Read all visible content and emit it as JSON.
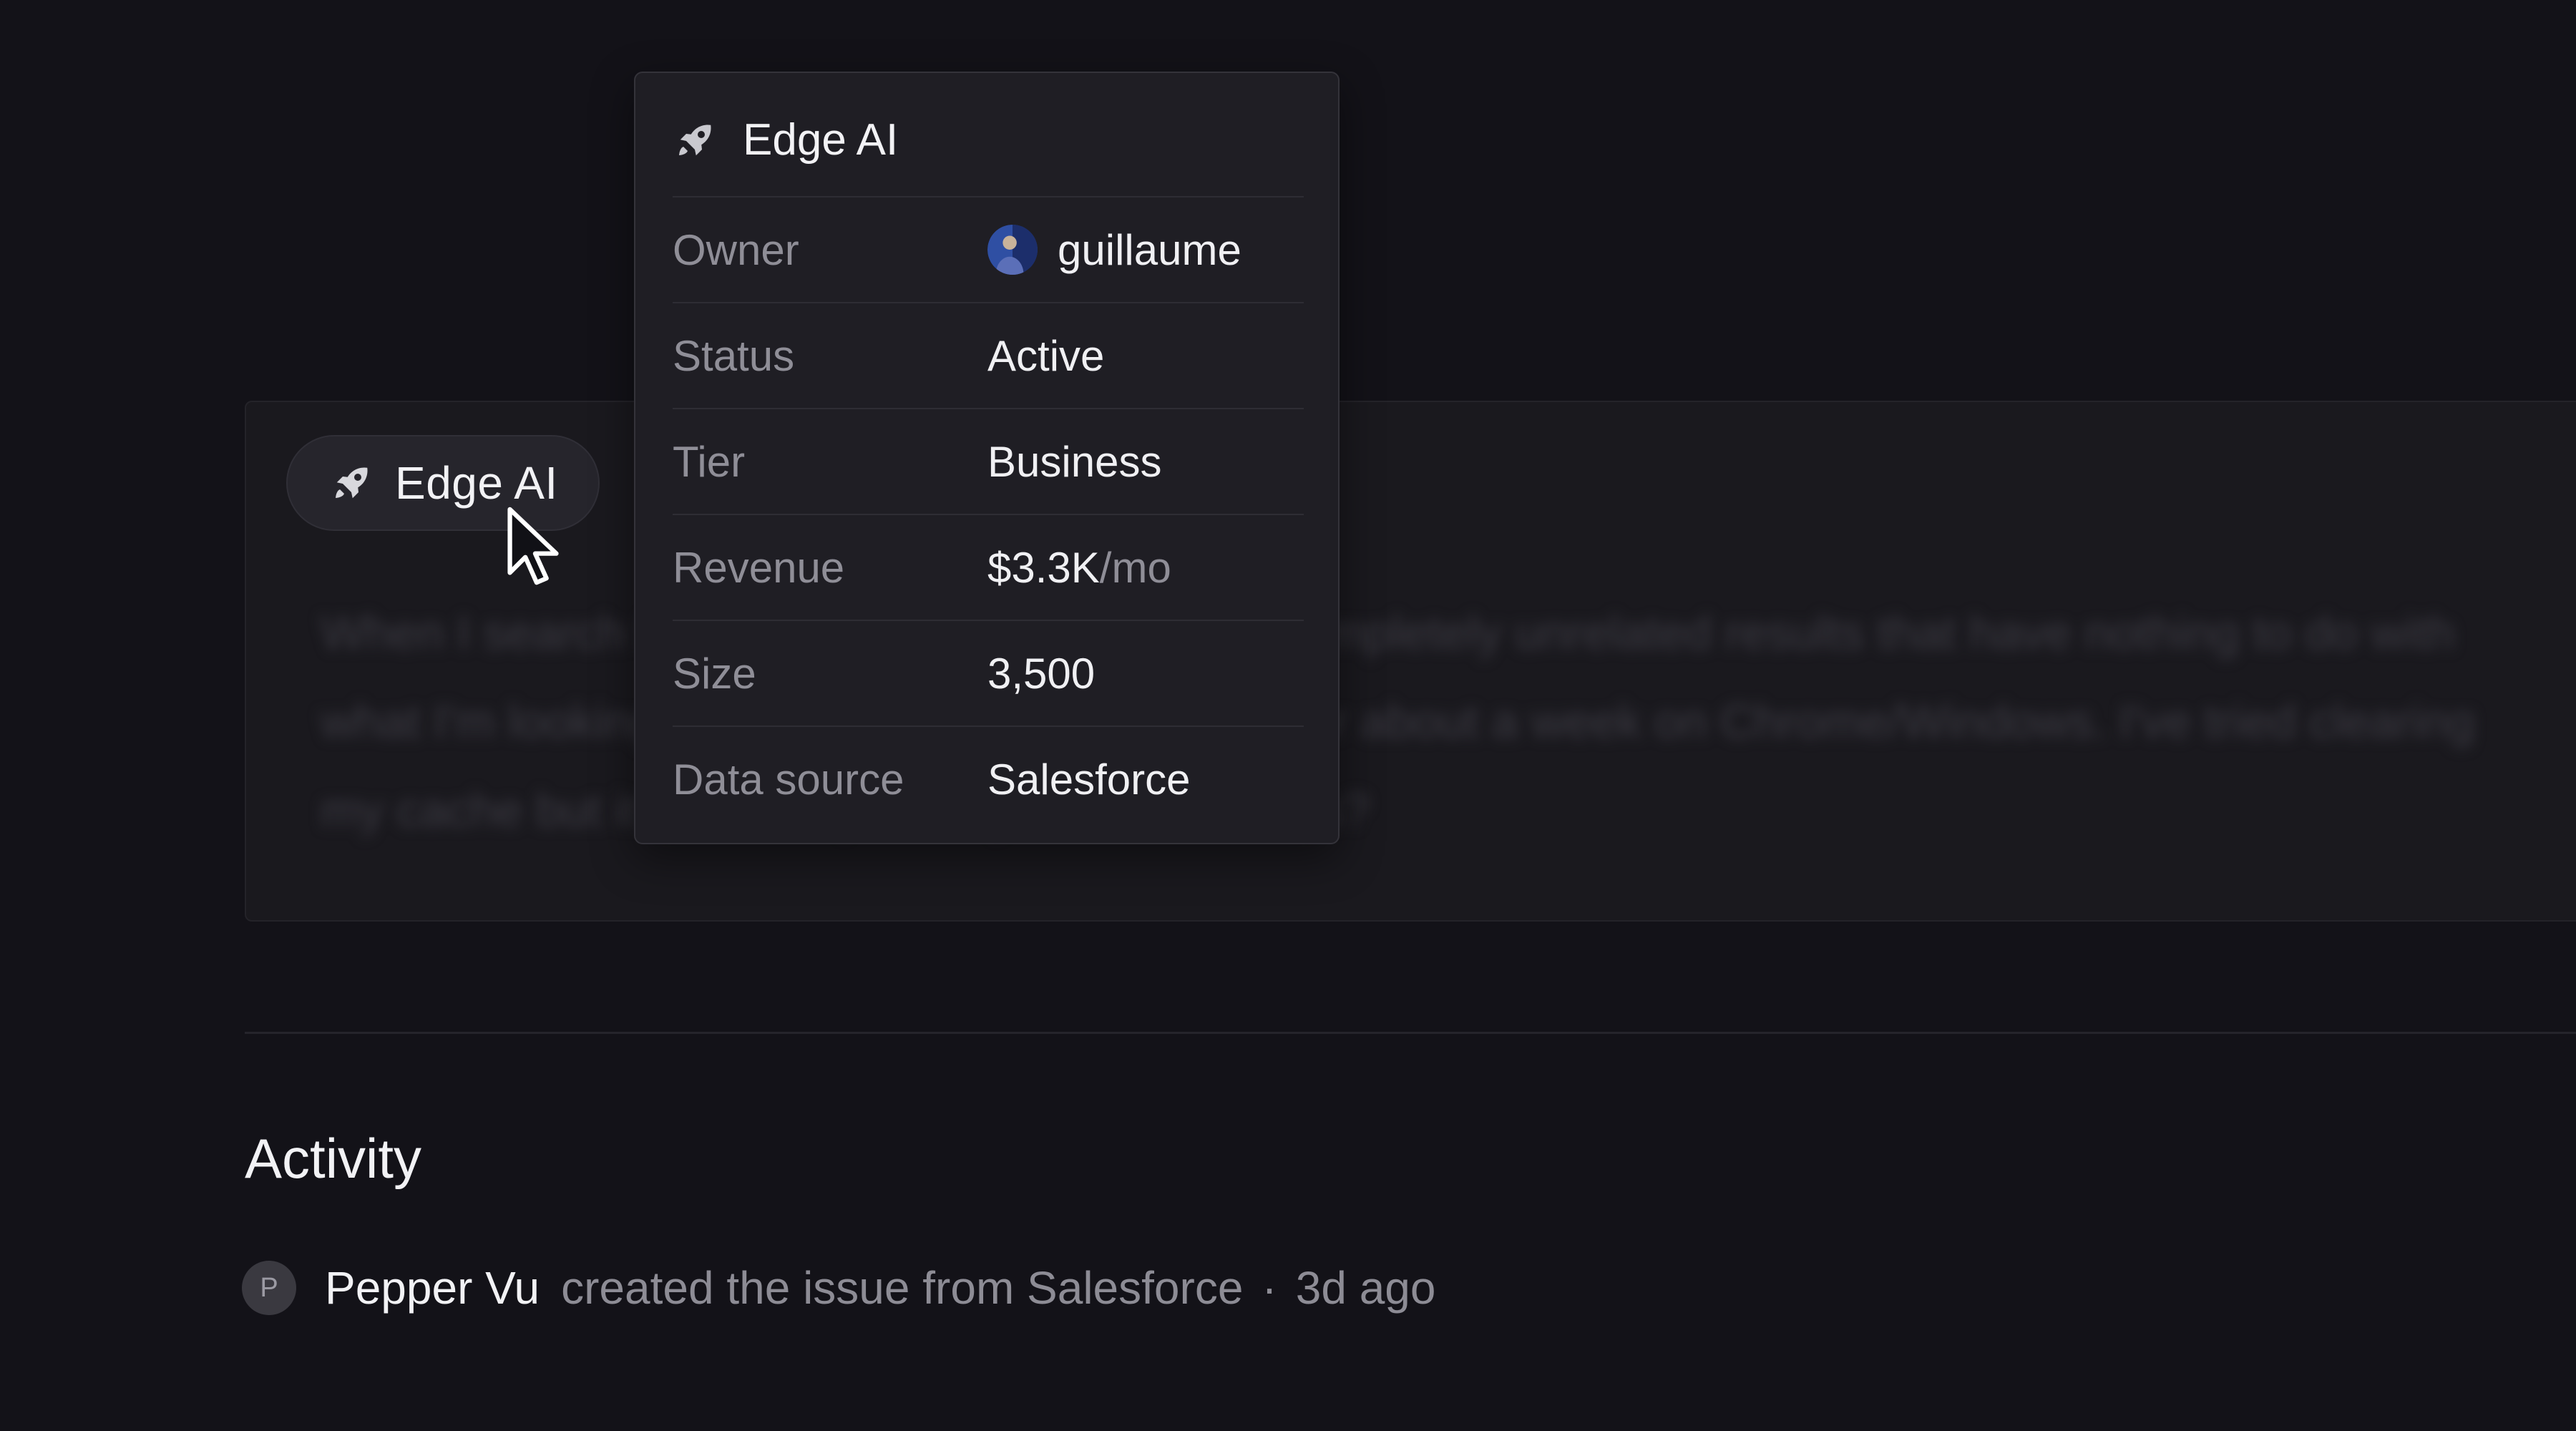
{
  "customer_chip": {
    "label": "Edge AI",
    "icon": "rocket-icon"
  },
  "issue": {
    "body_text": "When I search for products on your site, I get completely unrelated results that have nothing to do with what I'm looking for. This has been happening for about a week on Chrome/Windows. I've tried clearing my cache but it didn't help. Can you look into this?"
  },
  "popover": {
    "title": "Edge AI",
    "icon": "rocket-icon",
    "properties": [
      {
        "label": "Owner",
        "value": "guillaume"
      },
      {
        "label": "Status",
        "value": "Active"
      },
      {
        "label": "Tier",
        "value": "Business"
      },
      {
        "label": "Revenue",
        "value": "$3.3K",
        "unit": "/mo"
      },
      {
        "label": "Size",
        "value": "3,500"
      },
      {
        "label": "Data source",
        "value": "Salesforce"
      }
    ]
  },
  "activity": {
    "heading": "Activity",
    "items": [
      {
        "avatar_initial": "P",
        "actor": "Pepper Vu",
        "action": "created the issue from Salesforce",
        "separator": "·",
        "time": "3d ago"
      }
    ]
  },
  "colors": {
    "background": "#131218",
    "card": "#1a191e",
    "popover": "#1f1e24",
    "muted_text": "#8f8e97",
    "primary_text": "#f2f2f5"
  }
}
